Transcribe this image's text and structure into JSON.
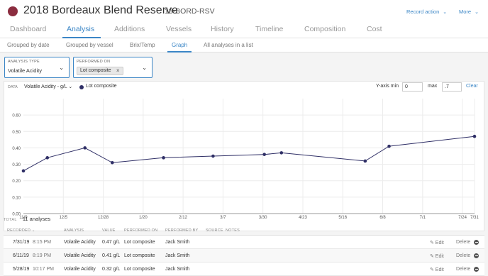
{
  "header": {
    "title": "2018 Bordeaux Blend Reserve",
    "code": "18-BORD-RSV",
    "record_action": "Record action",
    "more": "More",
    "chevron": "⌄",
    "dot_color": "#8b2d3f"
  },
  "tabs": [
    "Dashboard",
    "Analysis",
    "Additions",
    "Vessels",
    "History",
    "Timeline",
    "Composition",
    "Cost"
  ],
  "active_tab": "Analysis",
  "subtabs": [
    "Grouped by date",
    "Grouped by vessel",
    "Brix/Temp",
    "Graph",
    "All analyses in a list"
  ],
  "active_subtab": "Graph",
  "filters": {
    "analysis_type": {
      "label": "ANALYSIS TYPE",
      "value": "Volatile Acidity"
    },
    "performed_on": {
      "label": "PERFORMED ON",
      "chip": "Lot composite",
      "chip_close": "×"
    }
  },
  "chart_controls": {
    "data_label": "DATA",
    "data_value": "Volatile Acidity - g/L ⌄",
    "legend": "Lot composite",
    "ymin_label": "Y-axis min",
    "ymin_value": "0",
    "ymax_label": "max",
    "ymax_value": ".7",
    "clear": "Clear"
  },
  "chart_data": {
    "type": "line",
    "title": "",
    "xlabel": "",
    "ylabel": "",
    "ylim": [
      0,
      0.7
    ],
    "y_ticks": [
      "0.00",
      "0.10",
      "0.20",
      "0.30",
      "0.40",
      "0.50",
      "0.60"
    ],
    "x_ticks": [
      "11/9",
      "12/5",
      "12/28",
      "1/20",
      "2/12",
      "3/7",
      "3/30",
      "4/23",
      "5/16",
      "6/8",
      "7/1",
      "7/24",
      "7/31"
    ],
    "grid": true,
    "series": [
      {
        "name": "Lot composite",
        "color": "#2f2f66",
        "points": [
          {
            "x": "2018-11-09",
            "y": 0.26
          },
          {
            "x": "2018-11-23",
            "y": 0.34
          },
          {
            "x": "2018-12-15",
            "y": 0.4
          },
          {
            "x": "2018-12-31",
            "y": 0.31
          },
          {
            "x": "2019-01-30",
            "y": 0.34
          },
          {
            "x": "2019-02-28",
            "y": 0.35
          },
          {
            "x": "2019-03-30",
            "y": 0.36
          },
          {
            "x": "2019-04-09",
            "y": 0.37
          },
          {
            "x": "2019-05-28",
            "y": 0.32
          },
          {
            "x": "2019-06-11",
            "y": 0.41
          },
          {
            "x": "2019-07-31",
            "y": 0.47
          }
        ]
      }
    ]
  },
  "total": {
    "label": "TOTAL",
    "value": "11 analyses"
  },
  "table": {
    "headers": [
      "RECORDED ⌄",
      "ANALYSIS",
      "VALUE",
      "PERFORMED ON",
      "PERFORMED BY",
      "SOURCE",
      "NOTES"
    ],
    "edit_label": "✎ Edit",
    "delete_label": "Delete",
    "rows": [
      {
        "date": "7/31/19",
        "time": "8:15 PM",
        "analysis": "Volatile Acidity",
        "value": "0.47 g/L",
        "on": "Lot composite",
        "by": "Jack Smith"
      },
      {
        "date": "6/11/19",
        "time": "8:19 PM",
        "analysis": "Volatile Acidity",
        "value": "0.41 g/L",
        "on": "Lot composite",
        "by": "Jack Smith"
      },
      {
        "date": "5/28/19",
        "time": "10:17 PM",
        "analysis": "Volatile Acidity",
        "value": "0.32 g/L",
        "on": "Lot composite",
        "by": "Jack Smith"
      }
    ]
  }
}
